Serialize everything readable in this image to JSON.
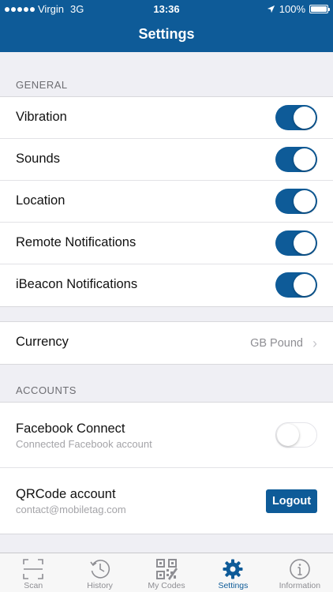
{
  "status_bar": {
    "carrier": "Virgin",
    "network": "3G",
    "time": "13:36",
    "battery": "100%",
    "battery_level": 1.0
  },
  "header": {
    "title": "Settings"
  },
  "general": {
    "section_label": "GENERAL",
    "items": [
      {
        "label": "Vibration",
        "on": true
      },
      {
        "label": "Sounds",
        "on": true
      },
      {
        "label": "Location",
        "on": true
      },
      {
        "label": "Remote Notifications",
        "on": true
      },
      {
        "label": "iBeacon Notifications",
        "on": true
      }
    ]
  },
  "currency": {
    "label": "Currency",
    "value": "GB Pound"
  },
  "accounts": {
    "section_label": "ACCOUNTS",
    "facebook": {
      "label": "Facebook Connect",
      "sub": "Connected Facebook account",
      "on": false
    },
    "qrcode": {
      "label": "QRCode account",
      "sub": "contact@mobiletag.com",
      "button": "Logout"
    }
  },
  "tabbar": {
    "active": "Settings",
    "tabs": [
      {
        "label": "Scan",
        "icon": "scan-icon"
      },
      {
        "label": "History",
        "icon": "history-icon"
      },
      {
        "label": "My Codes",
        "icon": "qr-code-icon"
      },
      {
        "label": "Settings",
        "icon": "gear-icon"
      },
      {
        "label": "Information",
        "icon": "info-icon"
      }
    ]
  },
  "colors": {
    "accent": "#0e5b98",
    "background": "#efeff4",
    "inactive_tab": "#8e8e93"
  }
}
